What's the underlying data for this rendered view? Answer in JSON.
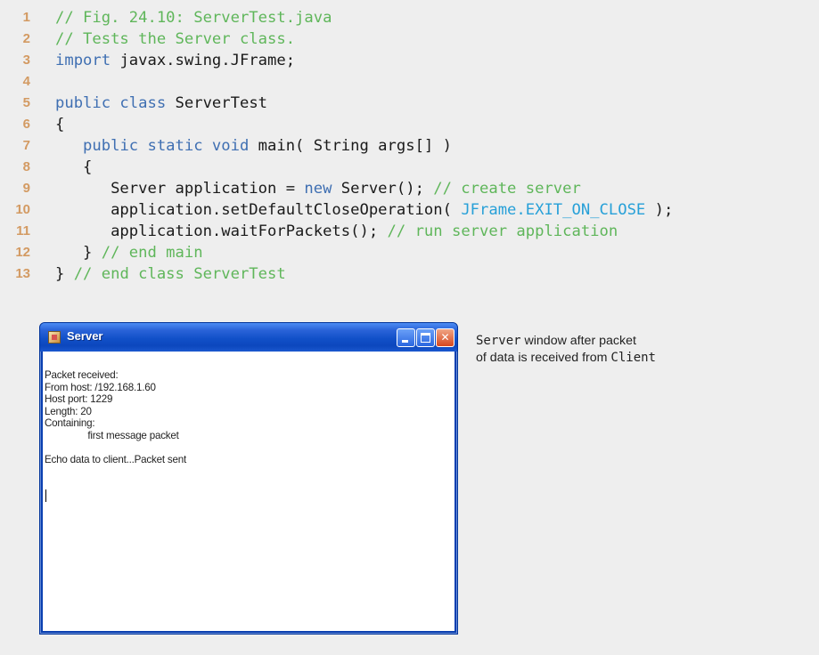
{
  "listing": {
    "lines": [
      {
        "number": "1",
        "tokens": [
          {
            "kind": "plain",
            "text": ""
          },
          {
            "kind": "comment",
            "text": "// Fig. 24.10: ServerTest.java"
          }
        ]
      },
      {
        "number": "2",
        "tokens": [
          {
            "kind": "comment",
            "text": "// Tests the Server class."
          }
        ]
      },
      {
        "number": "3",
        "tokens": [
          {
            "kind": "keyword",
            "text": "import"
          },
          {
            "kind": "plain",
            "text": " javax.swing.JFrame;"
          }
        ]
      },
      {
        "number": "4",
        "tokens": []
      },
      {
        "number": "5",
        "tokens": [
          {
            "kind": "keyword",
            "text": "public class"
          },
          {
            "kind": "plain",
            "text": " ServerTest"
          }
        ]
      },
      {
        "number": "6",
        "tokens": [
          {
            "kind": "plain",
            "text": "{"
          }
        ]
      },
      {
        "number": "7",
        "tokens": [
          {
            "kind": "plain",
            "text": "   "
          },
          {
            "kind": "keyword",
            "text": "public static void"
          },
          {
            "kind": "plain",
            "text": " main( String args[] )"
          }
        ]
      },
      {
        "number": "8",
        "tokens": [
          {
            "kind": "plain",
            "text": "   {"
          }
        ]
      },
      {
        "number": "9",
        "tokens": [
          {
            "kind": "plain",
            "text": "      Server application = "
          },
          {
            "kind": "keyword",
            "text": "new"
          },
          {
            "kind": "plain",
            "text": " Server(); "
          },
          {
            "kind": "comment",
            "text": "// create server"
          }
        ]
      },
      {
        "number": "10",
        "tokens": [
          {
            "kind": "plain",
            "text": "      application.setDefaultCloseOperation( "
          },
          {
            "kind": "const",
            "text": "JFrame.EXIT_ON_CLOSE"
          },
          {
            "kind": "plain",
            "text": " );"
          }
        ]
      },
      {
        "number": "11",
        "tokens": [
          {
            "kind": "plain",
            "text": "      application.waitForPackets(); "
          },
          {
            "kind": "comment",
            "text": "// run server application"
          }
        ]
      },
      {
        "number": "12",
        "tokens": [
          {
            "kind": "plain",
            "text": "   } "
          },
          {
            "kind": "comment",
            "text": "// end main"
          }
        ]
      },
      {
        "number": "13",
        "tokens": [
          {
            "kind": "plain",
            "text": "} "
          },
          {
            "kind": "comment",
            "text": "// end class ServerTest"
          }
        ]
      }
    ]
  },
  "window": {
    "title": "Server",
    "minimize_icon": "minimize-icon",
    "maximize_icon": "maximize-icon",
    "close_icon": "close-icon",
    "close_glyph": "✕",
    "output_text": "Packet received:\nFrom host: /192.168.1.60\nHost port: 1229\nLength: 20\nContaining:\n\t\tfirst message packet\n\nEcho data to client...Packet sent"
  },
  "caption": {
    "part1_mono": "Server",
    "part2": " window after packet",
    "part3": "of data is received from ",
    "part4_mono": "Client"
  },
  "colors": {
    "comment": "#5fb65a",
    "keyword": "#3f6fb2",
    "constant": "#27a0d8",
    "line_number": "#d39a62",
    "titlebar": "#1150c8"
  }
}
